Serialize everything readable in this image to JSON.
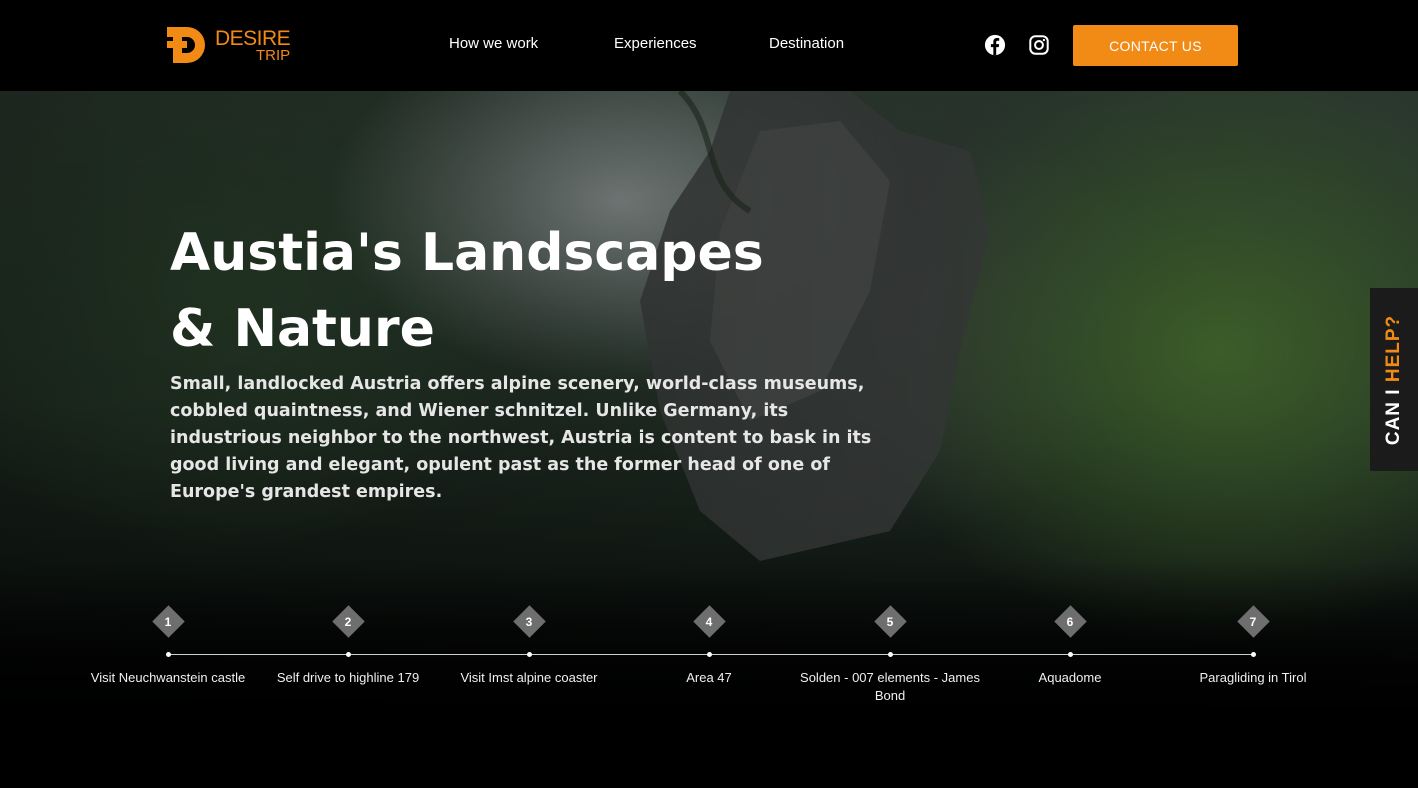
{
  "brand": {
    "name_line1": "DESIRE",
    "name_line2": "TRIP",
    "accent_color": "#f28a16",
    "logo_icon": "desire-trip-logo"
  },
  "nav": {
    "items": [
      {
        "label": "How we work"
      },
      {
        "label": "Experiences"
      },
      {
        "label": "Destination"
      }
    ]
  },
  "social": {
    "icons": [
      "facebook-icon",
      "instagram-icon"
    ]
  },
  "header": {
    "contact_label": "CONTACT US"
  },
  "hero": {
    "title_line1": "Austia's Landscapes",
    "title_line2": "& Nature",
    "description": "Small, landlocked Austria offers alpine scenery, world-class museums, cobbled quaintness, and Wiener schnitzel. Unlike Germany, its industrious neighbor to the northwest, Austria is content to bask in its good living and elegant, opulent past as the former head of one of Europe's grandest empires."
  },
  "timeline": {
    "steps": [
      {
        "num": "1",
        "label": "Visit Neuchwanstein castle"
      },
      {
        "num": "2",
        "label": "Self drive to highline 179"
      },
      {
        "num": "3",
        "label": "Visit Imst alpine coaster"
      },
      {
        "num": "4",
        "label": "Area 47"
      },
      {
        "num": "5",
        "label": "Solden - 007 elements - James Bond"
      },
      {
        "num": "6",
        "label": "Aquadome"
      },
      {
        "num": "7",
        "label": "Paragliding in Tirol"
      }
    ]
  },
  "help": {
    "part1": "CAN I ",
    "part2": "HELP?"
  }
}
